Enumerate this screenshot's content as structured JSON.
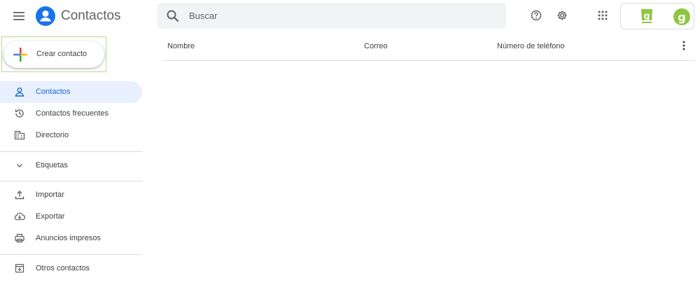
{
  "header": {
    "app_title": "Contactos",
    "search_placeholder": "Buscar",
    "icons": [
      "menu-icon",
      "contacts-logo-icon",
      "search-icon",
      "help-icon",
      "settings-icon",
      "apps-grid-icon"
    ]
  },
  "sidebar": {
    "create_label": "Crear contacto",
    "items": [
      {
        "label": "Contactos",
        "icon": "person-icon",
        "active": true
      },
      {
        "label": "Contactos frecuentes",
        "icon": "history-icon"
      },
      {
        "label": "Directorio",
        "icon": "domain-icon"
      },
      {
        "label": "Etiquetas",
        "icon": "chevron-down-icon"
      },
      {
        "label": "Importar",
        "icon": "upload-icon"
      },
      {
        "label": "Exportar",
        "icon": "cloud-download-icon"
      },
      {
        "label": "Anuncios impresos",
        "icon": "print-icon"
      },
      {
        "label": "Otros contactos",
        "icon": "archive-icon"
      }
    ]
  },
  "table": {
    "columns": [
      "Nombre",
      "Correo",
      "Número de teléfono"
    ]
  },
  "colors": {
    "accent": "#1a73e8",
    "active_bg": "#e8f0fe",
    "brand_green": "#8dc63f"
  }
}
